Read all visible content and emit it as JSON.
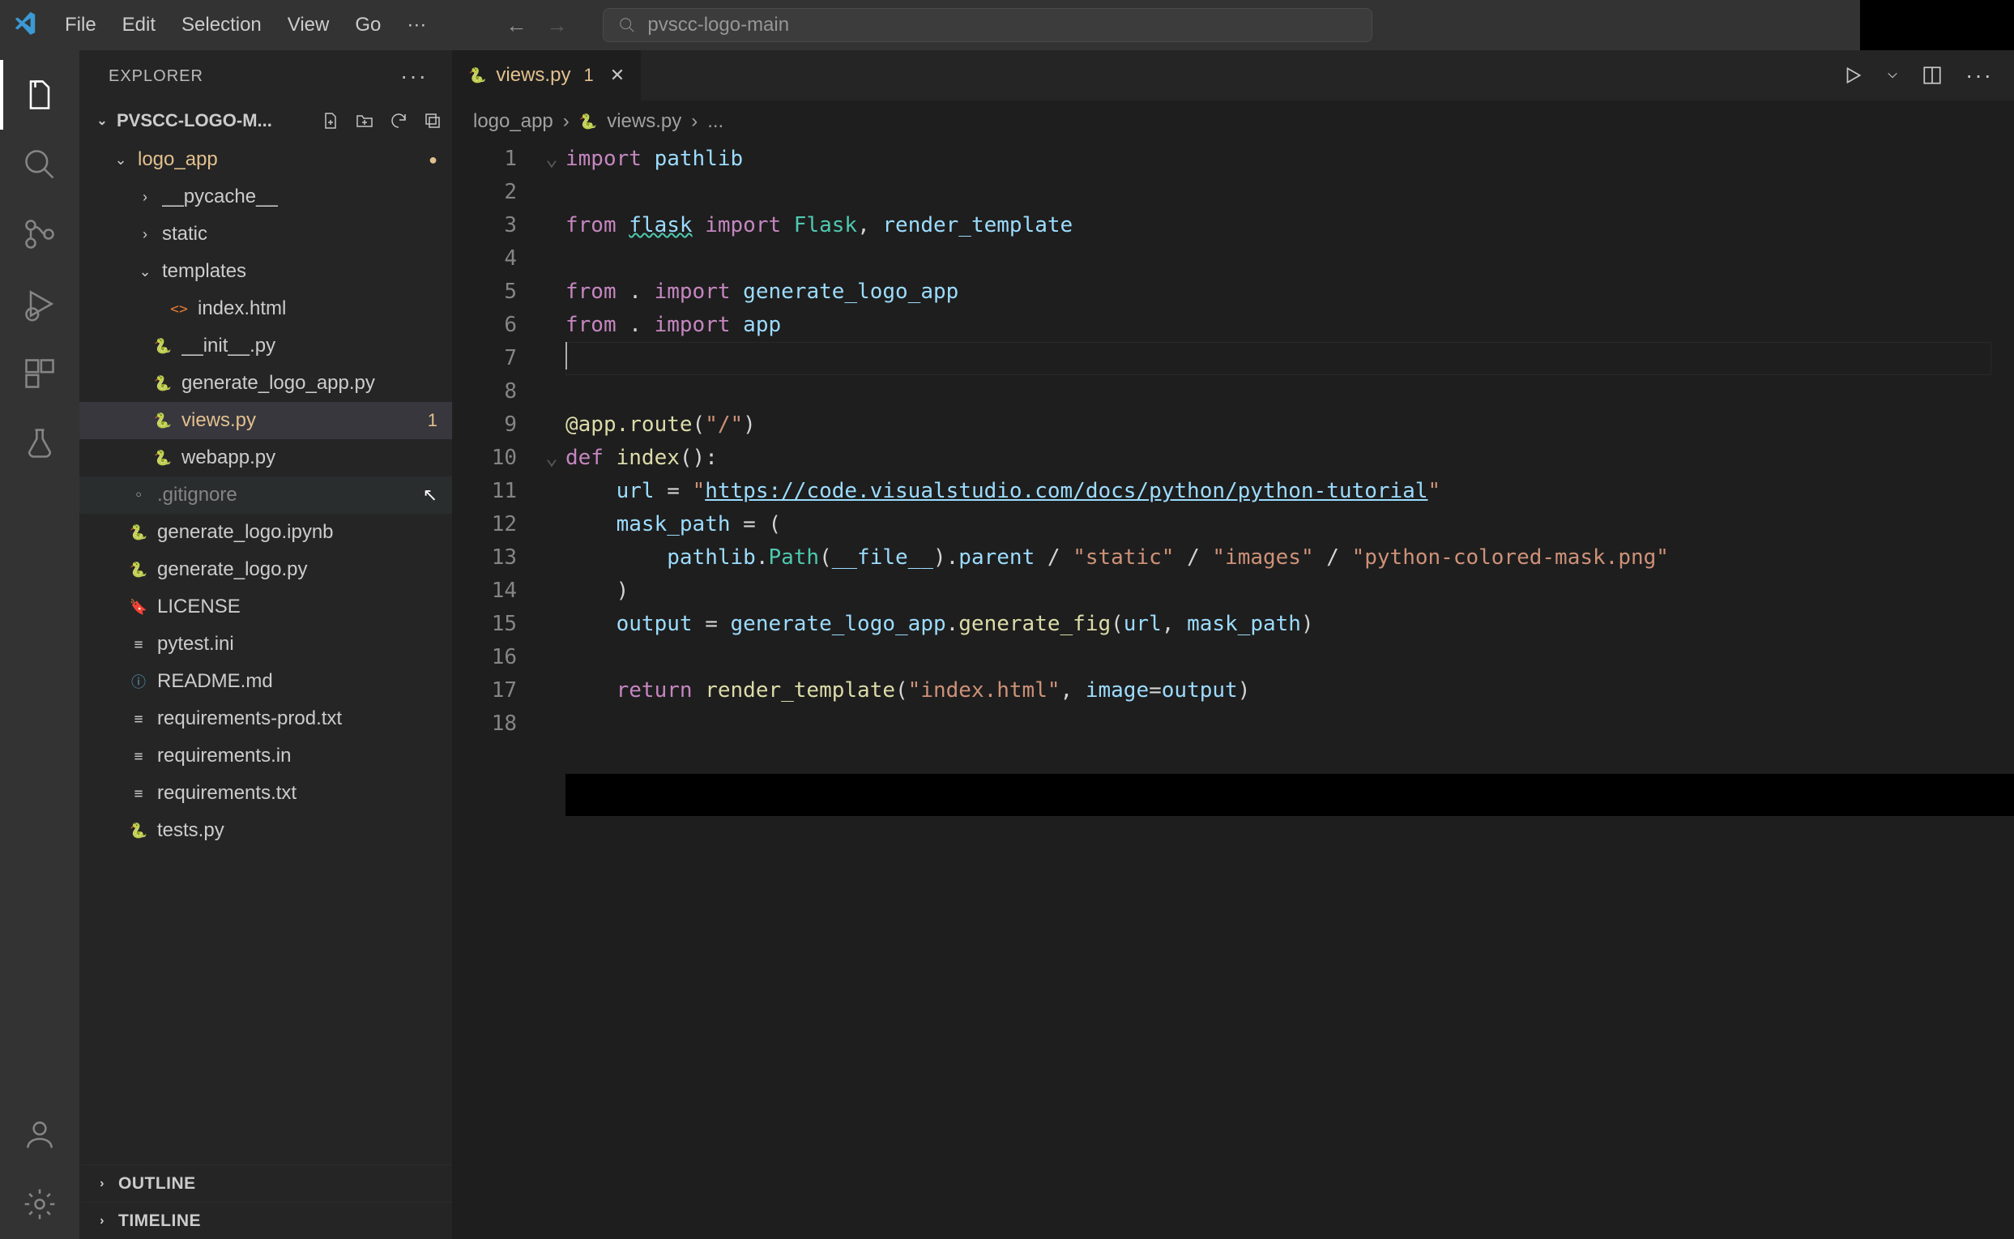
{
  "menubar": {
    "items": [
      "File",
      "Edit",
      "Selection",
      "View",
      "Go"
    ]
  },
  "commandCenter": {
    "text": "pvscc-logo-main"
  },
  "explorer": {
    "title": "EXPLORER",
    "folderName": "PVSCC-LOGO-M...",
    "tree": {
      "logo_app": {
        "label": "logo_app",
        "children": {
          "pycache": "__pycache__",
          "static": "static",
          "templates": {
            "label": "templates",
            "index": "index.html"
          },
          "init": "__init__.py",
          "generate": "generate_logo_app.py",
          "views": "views.py",
          "viewsBadge": "1",
          "webapp": "webapp.py"
        }
      },
      "gitignore": ".gitignore",
      "ipynb": "generate_logo.ipynb",
      "genpy": "generate_logo.py",
      "license": "LICENSE",
      "pytest": "pytest.ini",
      "readme": "README.md",
      "reqprod": "requirements-prod.txt",
      "reqin": "requirements.in",
      "reqtxt": "requirements.txt",
      "tests": "tests.py"
    },
    "outline": "OUTLINE",
    "timeline": "TIMELINE"
  },
  "tab": {
    "name": "views.py",
    "badge": "1"
  },
  "breadcrumb": {
    "p1": "logo_app",
    "p2": "views.py",
    "p3": "..."
  },
  "code": {
    "lines": 18,
    "l1": {
      "a": "import",
      "b": "pathlib"
    },
    "l3": {
      "a": "from",
      "b": "flask",
      "c": "import",
      "d": "Flask",
      "e": ", ",
      "f": "render_template"
    },
    "l5": {
      "a": "from",
      "b": " . ",
      "c": "import",
      "d": "generate_logo_app"
    },
    "l6": {
      "a": "from",
      "b": " . ",
      "c": "import",
      "d": "app"
    },
    "l9": {
      "a": "@app.route",
      "b": "(",
      "c": "\"/\"",
      "d": ")"
    },
    "l10": {
      "a": "def",
      "b": "index",
      "c": "():"
    },
    "l11": {
      "a": "url",
      "b": " = ",
      "c": "\"",
      "d": "https://code.visualstudio.com/docs/python/python-tutorial",
      "e": "\""
    },
    "l12": {
      "a": "mask_path",
      "b": " = ("
    },
    "l13": {
      "a": "pathlib",
      "b": ".",
      "c": "Path",
      "d": "(",
      "e": "__file__",
      "f": ").",
      "g": "parent",
      "h": " / ",
      "i": "\"static\"",
      "j": " / ",
      "k": "\"images\"",
      "l": " / ",
      "m": "\"python-colored-mask.png\""
    },
    "l14": {
      "a": ")"
    },
    "l15": {
      "a": "output",
      "b": " = ",
      "c": "generate_logo_app",
      "d": ".",
      "e": "generate_fig",
      "f": "(",
      "g": "url",
      "h": ", ",
      "i": "mask_path",
      "j": ")"
    },
    "l17": {
      "a": "return",
      "b": "render_template",
      "c": "(",
      "d": "\"index.html\"",
      "e": ", ",
      "f": "image",
      "g": "=",
      "h": "output",
      "i": ")"
    }
  }
}
